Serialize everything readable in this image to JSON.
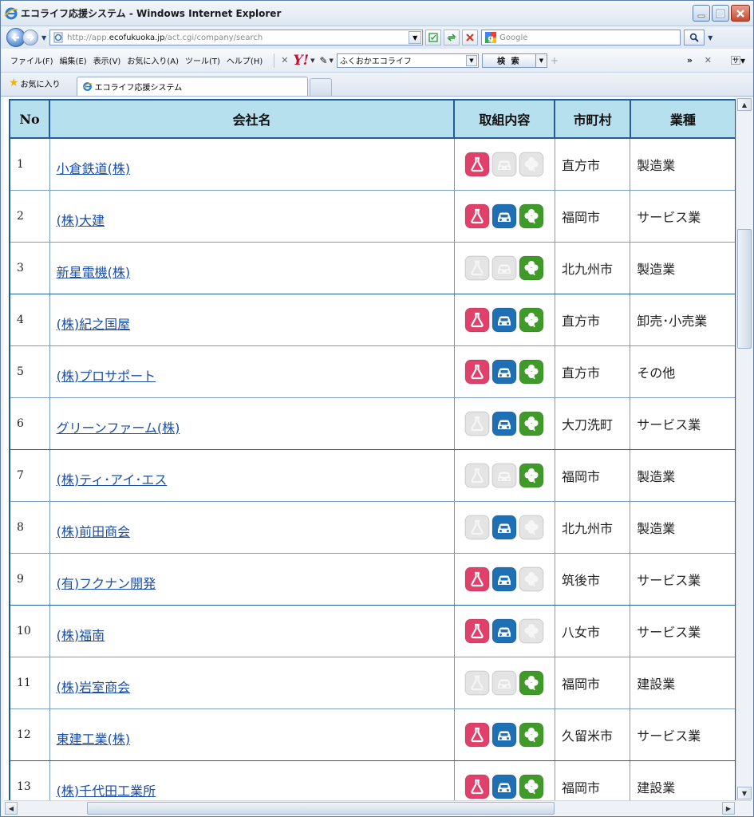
{
  "window": {
    "title": "エコライフ応援システム - Windows Internet Explorer",
    "icon": "ie-icon"
  },
  "address": {
    "url_prefix": "http://app.",
    "url_host": "ecofukuoka.jp",
    "url_path": "/act.cgi/company/search",
    "search_placeholder": "Google"
  },
  "menu": {
    "items": [
      "ファイル(F)",
      "編集(E)",
      "表示(V)",
      "お気に入り(A)",
      "ツール(T)",
      "ヘルプ(H)"
    ]
  },
  "yahoo_toolbar": {
    "logo": "Y!",
    "search_value": "ふくおかエコライフ",
    "search_button": "検 索"
  },
  "favorites": {
    "label": "お気に入り",
    "tab_title": "エコライフ応援システム"
  },
  "table": {
    "headers": {
      "no": "No",
      "company": "会社名",
      "activities": "取組内容",
      "city": "市町村",
      "industry": "業種"
    },
    "activity_types": [
      "flask",
      "car",
      "clover"
    ],
    "activity_colors": {
      "flask": "#e0406a",
      "car": "#1f6fb5",
      "clover": "#3f9a2a",
      "inactive": "#e4e4e4"
    },
    "rows": [
      {
        "no": "1",
        "company": "小倉鉄道(株)",
        "a": [
          true,
          false,
          false
        ],
        "city": "直方市",
        "industry": "製造業"
      },
      {
        "no": "2",
        "company": "(株)大建",
        "a": [
          true,
          true,
          true
        ],
        "city": "福岡市",
        "industry": "サービス業"
      },
      {
        "no": "3",
        "company": "新星電機(株)",
        "a": [
          false,
          false,
          true
        ],
        "city": "北九州市",
        "industry": "製造業"
      },
      {
        "no": "4",
        "company": "(株)紀之国屋",
        "a": [
          true,
          true,
          true
        ],
        "city": "直方市",
        "industry": "卸売･小売業"
      },
      {
        "no": "5",
        "company": "(株)プロサポート",
        "a": [
          true,
          true,
          true
        ],
        "city": "直方市",
        "industry": "その他"
      },
      {
        "no": "6",
        "company": "グリーンファーム(株)",
        "a": [
          false,
          true,
          true
        ],
        "city": "大刀洗町",
        "industry": "サービス業"
      },
      {
        "no": "7",
        "company": "(株)ティ･アイ･エス",
        "a": [
          false,
          false,
          true
        ],
        "city": "福岡市",
        "industry": "製造業"
      },
      {
        "no": "8",
        "company": "(株)前田商会",
        "a": [
          false,
          true,
          false
        ],
        "city": "北九州市",
        "industry": "製造業"
      },
      {
        "no": "9",
        "company": "(有)フクナン開発",
        "a": [
          true,
          true,
          false
        ],
        "city": "筑後市",
        "industry": "サービス業"
      },
      {
        "no": "10",
        "company": "(株)福南",
        "a": [
          true,
          true,
          false
        ],
        "city": "八女市",
        "industry": "サービス業"
      },
      {
        "no": "11",
        "company": "(株)岩室商会",
        "a": [
          false,
          false,
          true
        ],
        "city": "福岡市",
        "industry": "建設業"
      },
      {
        "no": "12",
        "company": "東建工業(株)",
        "a": [
          true,
          true,
          true
        ],
        "city": "久留米市",
        "industry": "サービス業"
      },
      {
        "no": "13",
        "company": "(株)千代田工業所",
        "a": [
          true,
          true,
          true
        ],
        "city": "福岡市",
        "industry": "建設業"
      }
    ]
  }
}
